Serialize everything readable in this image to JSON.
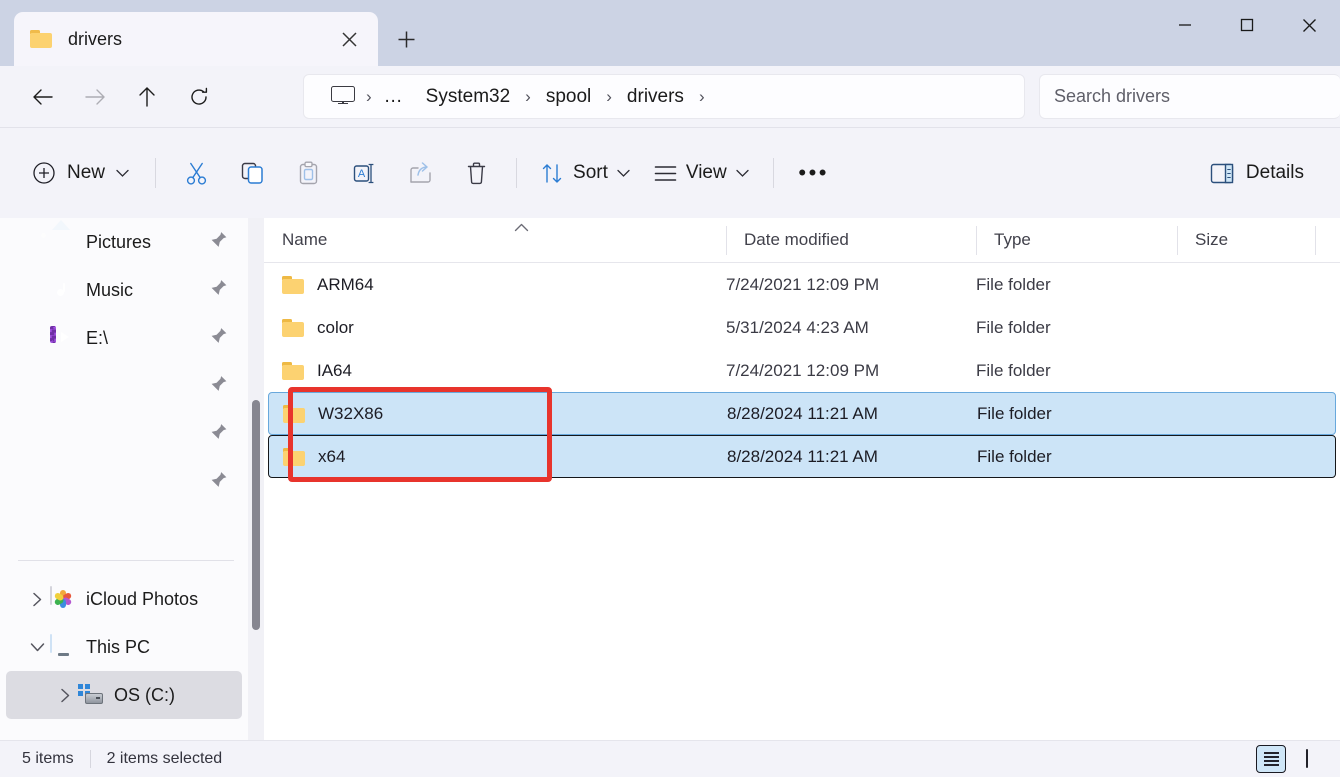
{
  "window": {
    "tab_title": "drivers",
    "tab_folder_icon": "folder-icon",
    "close_tab_icon": "close-icon",
    "new_tab_icon": "plus-icon",
    "minimize_icon": "minimize-icon",
    "maximize_icon": "maximize-icon",
    "close_icon": "close-icon"
  },
  "navigation": {
    "back_icon": "arrow-left-icon",
    "forward_icon": "arrow-right-icon",
    "up_icon": "arrow-up-icon",
    "refresh_icon": "refresh-icon"
  },
  "address_bar": {
    "root_icon": "this-pc-icon",
    "overflow": "…",
    "separator": "›",
    "crumbs": [
      "System32",
      "spool",
      "drivers"
    ]
  },
  "search": {
    "placeholder": "Search drivers",
    "value": ""
  },
  "toolbar": {
    "new_label": "New",
    "new_icon": "plus-circle-icon",
    "cut_icon": "scissors-icon",
    "copy_icon": "copy-icon",
    "paste_icon": "paste-icon",
    "rename_icon": "rename-icon",
    "share_icon": "share-icon",
    "delete_icon": "trash-icon",
    "sort_label": "Sort",
    "sort_icon": "sort-arrows-icon",
    "view_label": "View",
    "view_icon": "list-lines-icon",
    "more_label": "•••",
    "details_label": "Details",
    "details_icon": "details-pane-icon"
  },
  "sidebar": {
    "items": [
      {
        "label": "Pictures",
        "icon": "pictures-icon",
        "pinned": true,
        "expander": "none",
        "selected": false
      },
      {
        "label": "Music",
        "icon": "music-icon",
        "pinned": true,
        "expander": "none",
        "selected": false
      },
      {
        "label": "E:\\",
        "icon": "drive-e-icon",
        "pinned": true,
        "expander": "none",
        "selected": false
      },
      {
        "label": "",
        "icon": "none",
        "pinned": true,
        "expander": "none",
        "selected": false
      },
      {
        "label": "",
        "icon": "none",
        "pinned": true,
        "expander": "none",
        "selected": false
      },
      {
        "label": "",
        "icon": "none",
        "pinned": true,
        "expander": "none",
        "selected": false
      }
    ],
    "lower_items": [
      {
        "label": "iCloud Photos",
        "icon": "icloud-photos-icon",
        "expander": "collapsed",
        "selected": false
      },
      {
        "label": "This PC",
        "icon": "this-pc-icon",
        "expander": "expanded",
        "selected": false
      },
      {
        "label": "OS (C:)",
        "icon": "os-drive-icon",
        "expander": "collapsed",
        "selected": true
      }
    ],
    "pin_icon": "pin-icon"
  },
  "file_list": {
    "columns": [
      "Name",
      "Date modified",
      "Type",
      "Size"
    ],
    "sort_column": "Name",
    "sort_direction_icon": "chevron-up-icon",
    "rows": [
      {
        "name": "ARM64",
        "date_modified": "7/24/2021 12:09 PM",
        "type": "File folder",
        "size": "",
        "icon": "folder-icon",
        "selected": false,
        "focus": "none"
      },
      {
        "name": "color",
        "date_modified": "5/31/2024 4:23 AM",
        "type": "File folder",
        "size": "",
        "icon": "folder-icon",
        "selected": false,
        "focus": "none"
      },
      {
        "name": "IA64",
        "date_modified": "7/24/2021 12:09 PM",
        "type": "File folder",
        "size": "",
        "icon": "folder-icon",
        "selected": false,
        "focus": "none"
      },
      {
        "name": "W32X86",
        "date_modified": "8/28/2024 11:21 AM",
        "type": "File folder",
        "size": "",
        "icon": "folder-icon",
        "selected": true,
        "focus": "soft"
      },
      {
        "name": "x64",
        "date_modified": "8/28/2024 11:21 AM",
        "type": "File folder",
        "size": "",
        "icon": "folder-icon",
        "selected": true,
        "focus": "hard"
      }
    ]
  },
  "annotation": {
    "color": "#e8342c",
    "shape": "rectangle",
    "targets": [
      "W32X86",
      "x64"
    ]
  },
  "status_bar": {
    "item_count": "5 items",
    "selection_count": "2 items selected",
    "details_view_icon": "details-view-icon",
    "large_icons_view_icon": "large-icons-view-icon",
    "active_view": "details"
  },
  "colors": {
    "titlebar": "#ccd3e4",
    "chrome": "#f3f3f9",
    "selection_fill": "#cce4f7",
    "selection_border_soft": "#68a8dc",
    "selection_border_hard": "#15171a",
    "accent_blue": "#2f86d8",
    "annotation_red": "#e8342c"
  }
}
